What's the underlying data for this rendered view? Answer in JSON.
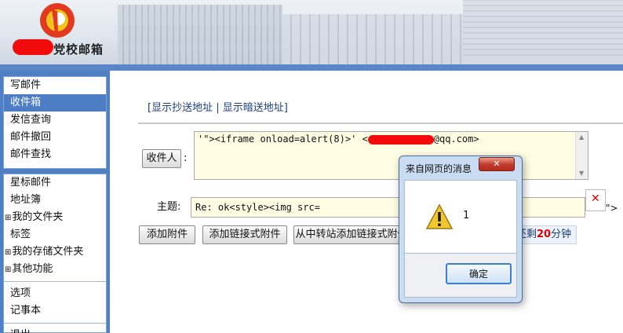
{
  "header": {
    "brand": "党校邮箱",
    "logo_icon": "school-logo-icon"
  },
  "sidebar": {
    "group1": [
      {
        "label": "写邮件",
        "active": false
      },
      {
        "label": "收件箱",
        "active": true
      },
      {
        "label": "发信查询",
        "active": false
      },
      {
        "label": "邮件撤回",
        "active": false
      },
      {
        "label": "邮件查找",
        "active": false
      }
    ],
    "group2": [
      {
        "label": "星标邮件"
      },
      {
        "label": "地址簿"
      },
      {
        "label": "我的文件夹",
        "expand": "⊞"
      },
      {
        "label": "标签"
      },
      {
        "label": "我的存储文件夹",
        "expand": "⊞"
      },
      {
        "label": "其他功能",
        "expand": "⊞"
      },
      {
        "label": "选项",
        "sep": true
      },
      {
        "label": "记事本"
      },
      {
        "label": "退出",
        "sep": true
      }
    ]
  },
  "compose": {
    "show_cc": "显示抄送地址",
    "show_bcc": "显示暗送地址",
    "recipient_button": "收件人",
    "recipient_value_prefix": "'\"><iframe onload=alert(8)>' <",
    "recipient_value_suffix": "@qq.com>",
    "subject_label": "主题:",
    "subject_value": "Re: ok<style><img src=",
    "overflow_text": "\">",
    "buttons": {
      "add_attachment": "添加附件",
      "add_link_attachment": "添加链接式附件",
      "transit_attachment": "从中转站添加链接式附件"
    },
    "time_prefix": "间还剩",
    "time_value": "20",
    "time_suffix": "分钟"
  },
  "dialog": {
    "title": "来自网页的消息",
    "close_label": "✕",
    "message": "1",
    "ok_label": "确定"
  },
  "colors": {
    "accent": "#4c7dc5",
    "redaction": "#f20b0b",
    "highlight": "#dd0000"
  }
}
